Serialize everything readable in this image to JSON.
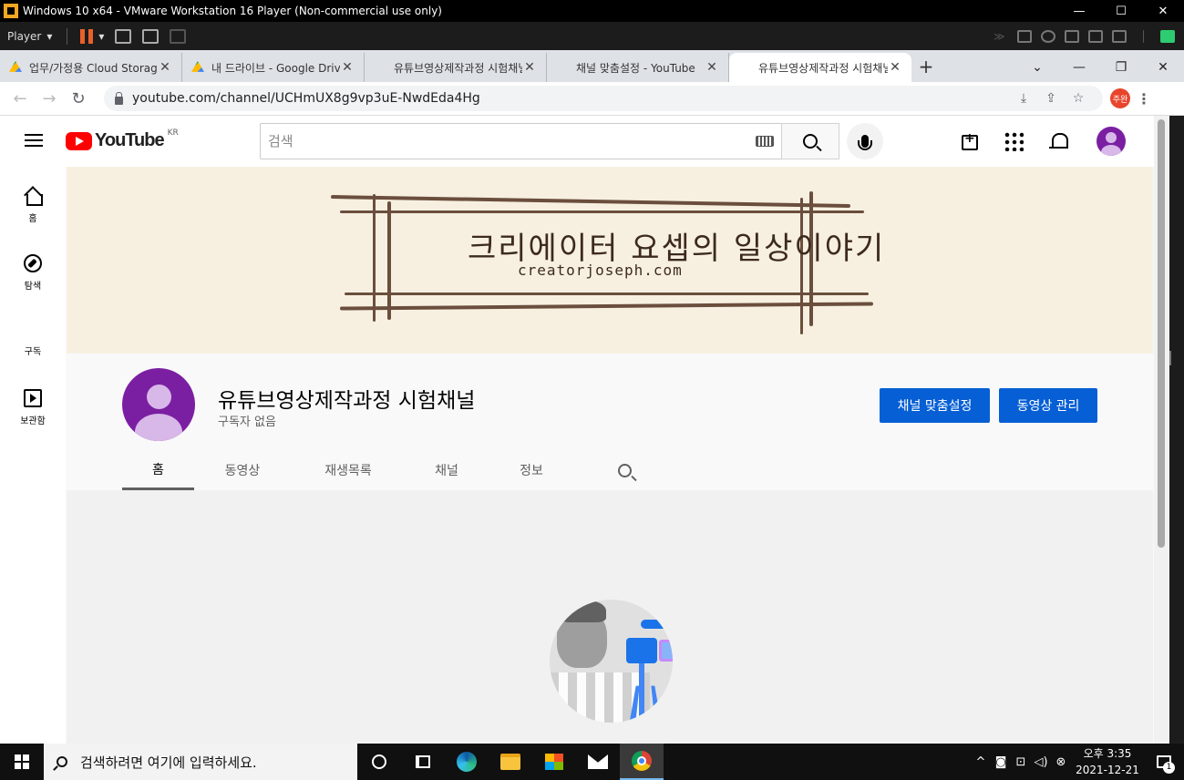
{
  "vm": {
    "title": "Windows 10 x64 - VMware Workstation 16 Player (Non-commercial use only)",
    "player_label": "Player",
    "min": "—",
    "max": "☐",
    "close": "✕"
  },
  "browser": {
    "tabs": [
      {
        "label": "업무/가정용 Cloud Storage",
        "icon": "google-drive-icon",
        "active": false
      },
      {
        "label": "내 드라이브 - Google Drive",
        "icon": "google-drive-icon",
        "active": false
      },
      {
        "label": "유튜브영상제작과정 시험채널",
        "icon": "youtube-icon",
        "active": false
      },
      {
        "label": "채널 맞춤설정 - YouTube",
        "icon": "youtube-icon",
        "active": false
      },
      {
        "label": "유튜브영상제작과정 시험채널",
        "icon": "youtube-icon",
        "active": true
      }
    ],
    "tab_close": "✕",
    "new_tab": "+",
    "url": "youtube.com/channel/UCHmUX8g9vp3uE-NwdEda4Hg",
    "profile_label": "주완"
  },
  "youtube": {
    "region": "KR",
    "search_placeholder": "검색",
    "guide": [
      {
        "label": "홈",
        "icon": "home-icon"
      },
      {
        "label": "탐색",
        "icon": "explore-icon"
      },
      {
        "label": "구독",
        "icon": "subscriptions-icon"
      },
      {
        "label": "보관함",
        "icon": "library-icon"
      }
    ],
    "banner": {
      "title": "크리에이터 요셉의 일상이야기",
      "subtitle": "creatorjoseph.com"
    },
    "channel": {
      "name": "유튜브영상제작과정 시험채널",
      "subscribers": "구독자 없음",
      "customize_button": "채널 맞춤설정",
      "manage_button": "동영상 관리"
    },
    "tabs": [
      "홈",
      "동영상",
      "재생목록",
      "채널",
      "정보"
    ],
    "active_tab": "홈"
  },
  "taskbar": {
    "search_placeholder": "검색하려면 여기에 입력하세요.",
    "time": "오후 3:35",
    "date": "2021-12-21",
    "notification_count": "1"
  },
  "colors": {
    "youtube_red": "#ff0000",
    "button_blue": "#065fd4",
    "avatar_purple": "#7b1fa2",
    "banner_bg": "#f7f0e1"
  }
}
